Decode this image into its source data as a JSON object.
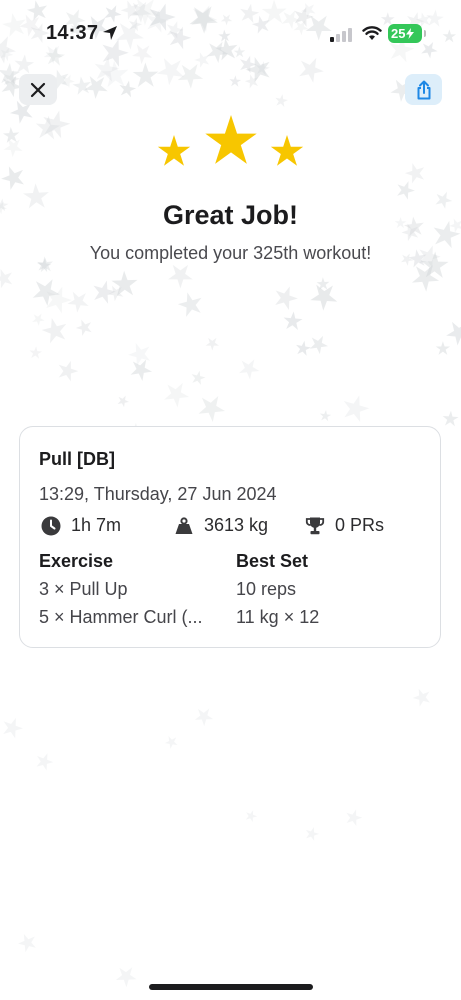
{
  "status_bar": {
    "time": "14:37",
    "battery": "25"
  },
  "header": {
    "close_icon": "close-icon",
    "share_icon": "share-icon"
  },
  "celebration": {
    "star_icon": "star-icon",
    "star_color": "#f7c600",
    "title": "Great Job!",
    "subtitle": "You completed your 325th workout!"
  },
  "workout": {
    "name": "Pull [DB]",
    "datetime": "13:29, Thursday, 27 Jun 2024",
    "duration": "1h 7m",
    "volume": "3613 kg",
    "prs": "0 PRs",
    "columns": {
      "exercise": "Exercise",
      "best_set": "Best Set"
    },
    "rows": [
      {
        "exercise": "3 × Pull Up",
        "best_set": "10 reps"
      },
      {
        "exercise": "5 × Hammer Curl (...",
        "best_set": "11 kg × 12"
      }
    ]
  },
  "colors": {
    "accent_blue": "#1e88e5",
    "battery_green": "#34c759"
  }
}
